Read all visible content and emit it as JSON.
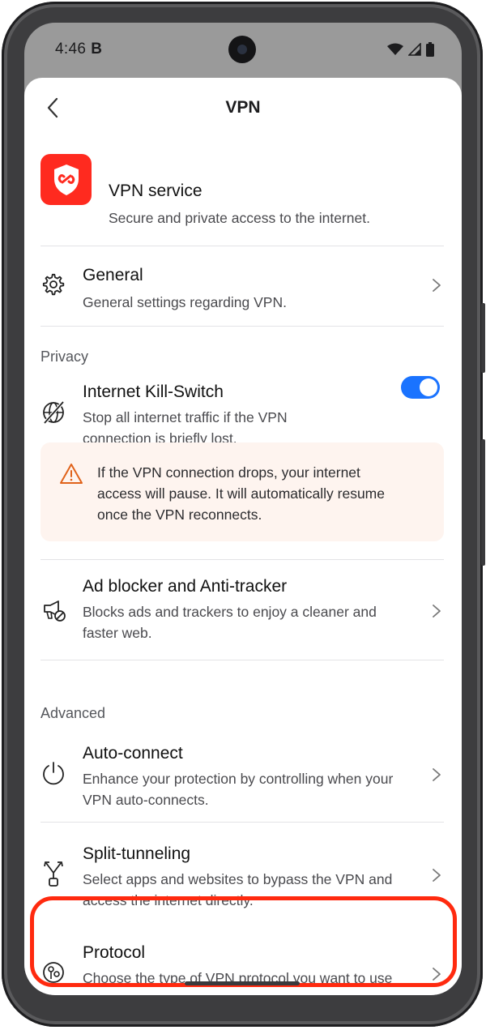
{
  "status_bar": {
    "time": "4:46",
    "notification": "B",
    "icons": [
      "wifi-icon",
      "cellular-icon",
      "battery-icon"
    ]
  },
  "header": {
    "title": "VPN",
    "back_icon": "chevron-left-icon"
  },
  "service": {
    "icon": "vpn-shield-icon",
    "title": "VPN service",
    "description": "Secure and private access to the internet."
  },
  "general": {
    "icon": "gear-icon",
    "title": "General",
    "description": "General settings regarding VPN."
  },
  "sections": {
    "privacy": "Privacy",
    "advanced": "Advanced"
  },
  "kill_switch": {
    "icon": "globe-slash-icon",
    "title": "Internet Kill-Switch",
    "description_line1": "Stop all internet traffic if the VPN",
    "description_line2": "connection is briefly lost.",
    "enabled": true
  },
  "warning": {
    "icon": "warning-triangle-icon",
    "line1": "If the VPN connection drops, your internet",
    "line2": "access will pause. It will automatically resume",
    "line3": "once the VPN reconnects."
  },
  "ad_blocker": {
    "icon": "megaphone-block-icon",
    "title": "Ad blocker and Anti-tracker",
    "line1": "Blocks ads and trackers to enjoy a cleaner and",
    "line2": "faster web."
  },
  "auto_connect": {
    "icon": "power-icon",
    "title": "Auto-connect",
    "line1": "Enhance your protection by controlling when your",
    "line2": "VPN auto-connects."
  },
  "split_tunneling": {
    "icon": "split-arrows-icon",
    "title": "Split-tunneling",
    "line1": "Select apps and websites to bypass the VPN and",
    "line2": "access the internet directly."
  },
  "protocol": {
    "icon": "protocol-icon",
    "title": "Protocol",
    "line1": "Choose the type of VPN protocol you want to use"
  },
  "colors": {
    "accent": "#1a73ff",
    "brand": "#ff2a1f",
    "highlight": "#ff2a0f",
    "warning": "#e0621a"
  }
}
